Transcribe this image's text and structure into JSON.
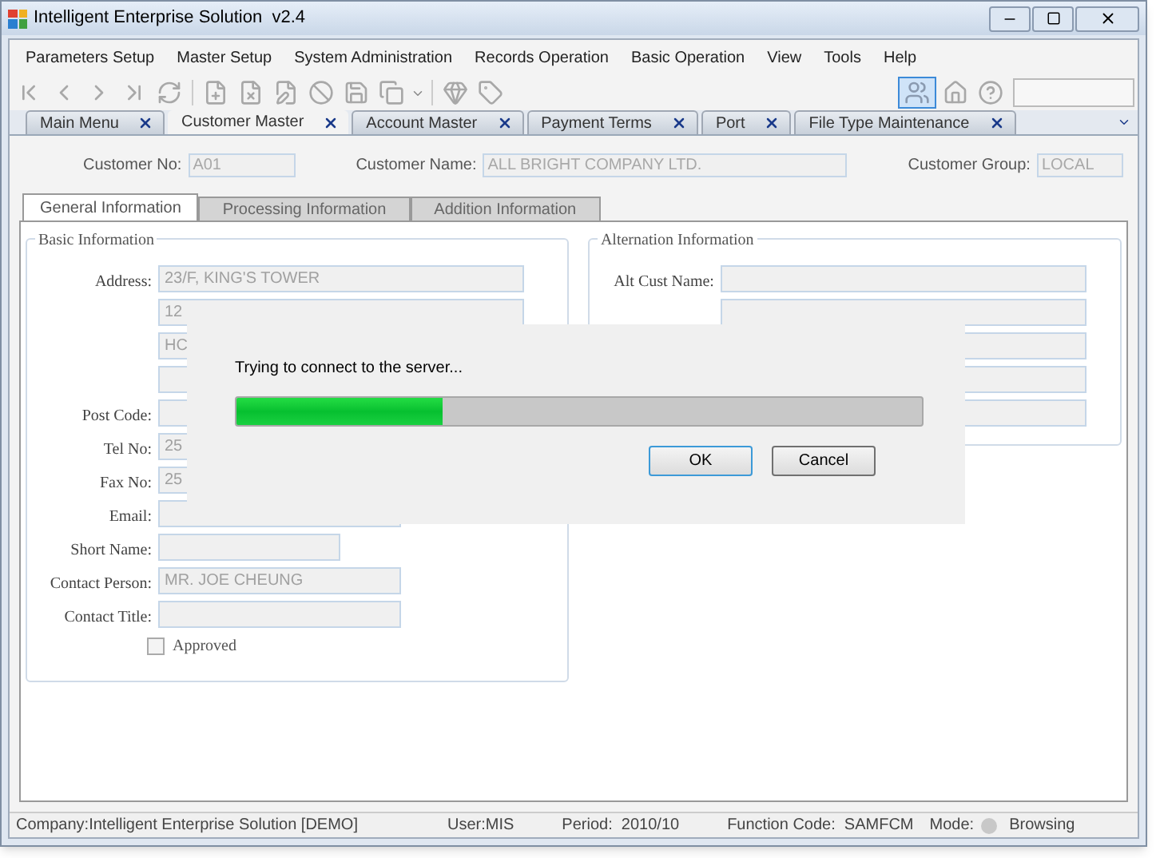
{
  "window": {
    "title": "Intelligent Enterprise Solution  v2.4"
  },
  "menu": [
    "Parameters Setup",
    "Master Setup",
    "System Administration",
    "Records Operation",
    "Basic Operation",
    "View",
    "Tools",
    "Help"
  ],
  "toolbar": {
    "users_selected": true
  },
  "tabs": [
    {
      "label": "Main Menu",
      "selected": false
    },
    {
      "label": "Customer Master",
      "selected": true
    },
    {
      "label": "Account Master",
      "selected": false
    },
    {
      "label": "Payment Terms",
      "selected": false
    },
    {
      "label": "Port",
      "selected": false
    },
    {
      "label": "File Type Maintenance",
      "selected": false
    }
  ],
  "header_fields": [
    {
      "label": "Customer No:",
      "value": "A01",
      "kind": "small"
    },
    {
      "label": "Customer Name:",
      "value": "ALL BRIGHT COMPANY LTD.",
      "kind": "large"
    },
    {
      "label": "Customer Group:",
      "value": "LOCAL",
      "kind": "tiny"
    }
  ],
  "form_tabs": [
    {
      "label": "General Information",
      "selected": true
    },
    {
      "label": "Processing Information",
      "selected": false
    },
    {
      "label": "Addition Information",
      "selected": false
    }
  ],
  "basic_info": {
    "title": "Basic Information",
    "fields": [
      {
        "label": "Address:",
        "value": "23/F, KING'S TOWER",
        "kind": "long"
      },
      {
        "value": "12",
        "kind": "long"
      },
      {
        "value": "HC",
        "kind": "long"
      },
      {
        "kind": "long"
      },
      {
        "label": "Post Code:",
        "kind": "medium"
      },
      {
        "label": "Tel No:",
        "value": "25",
        "kind": "medium"
      },
      {
        "label": "Fax No:",
        "value": "25",
        "kind": "medium"
      },
      {
        "label": "Email:",
        "kind": "medium"
      },
      {
        "label": "Short Name:",
        "kind": "short"
      },
      {
        "label": "Contact Person:",
        "value": "MR. JOE CHEUNG",
        "kind": "medium"
      },
      {
        "label": "Contact Title:",
        "kind": "medium"
      }
    ],
    "approved": {
      "label": "Approved",
      "checked": false
    }
  },
  "alternation_info": {
    "title": "Alternation Information",
    "fields": [
      {
        "label": "Alt Cust Name:",
        "kind": "long"
      },
      {
        "kind": "long"
      },
      {
        "kind": "long"
      },
      {
        "kind": "long"
      },
      {
        "kind": "long"
      }
    ]
  },
  "dialog": {
    "message": "Trying to connect to the server...",
    "level": 0.3,
    "buttons": [
      {
        "label": "OK",
        "kind": "default"
      },
      {
        "label": "Cancel",
        "kind": "normal"
      }
    ]
  },
  "status_bar": [
    {
      "text": "Company:Intelligent Enterprise Solution [DEMO]"
    },
    {
      "text": "User:MIS"
    },
    {
      "text": "Period:  2010/10"
    },
    {
      "text": "Function Code:  SAMFCM"
    },
    {
      "text": "Mode:",
      "kind": "mode"
    },
    {
      "text": "Browsing"
    }
  ]
}
